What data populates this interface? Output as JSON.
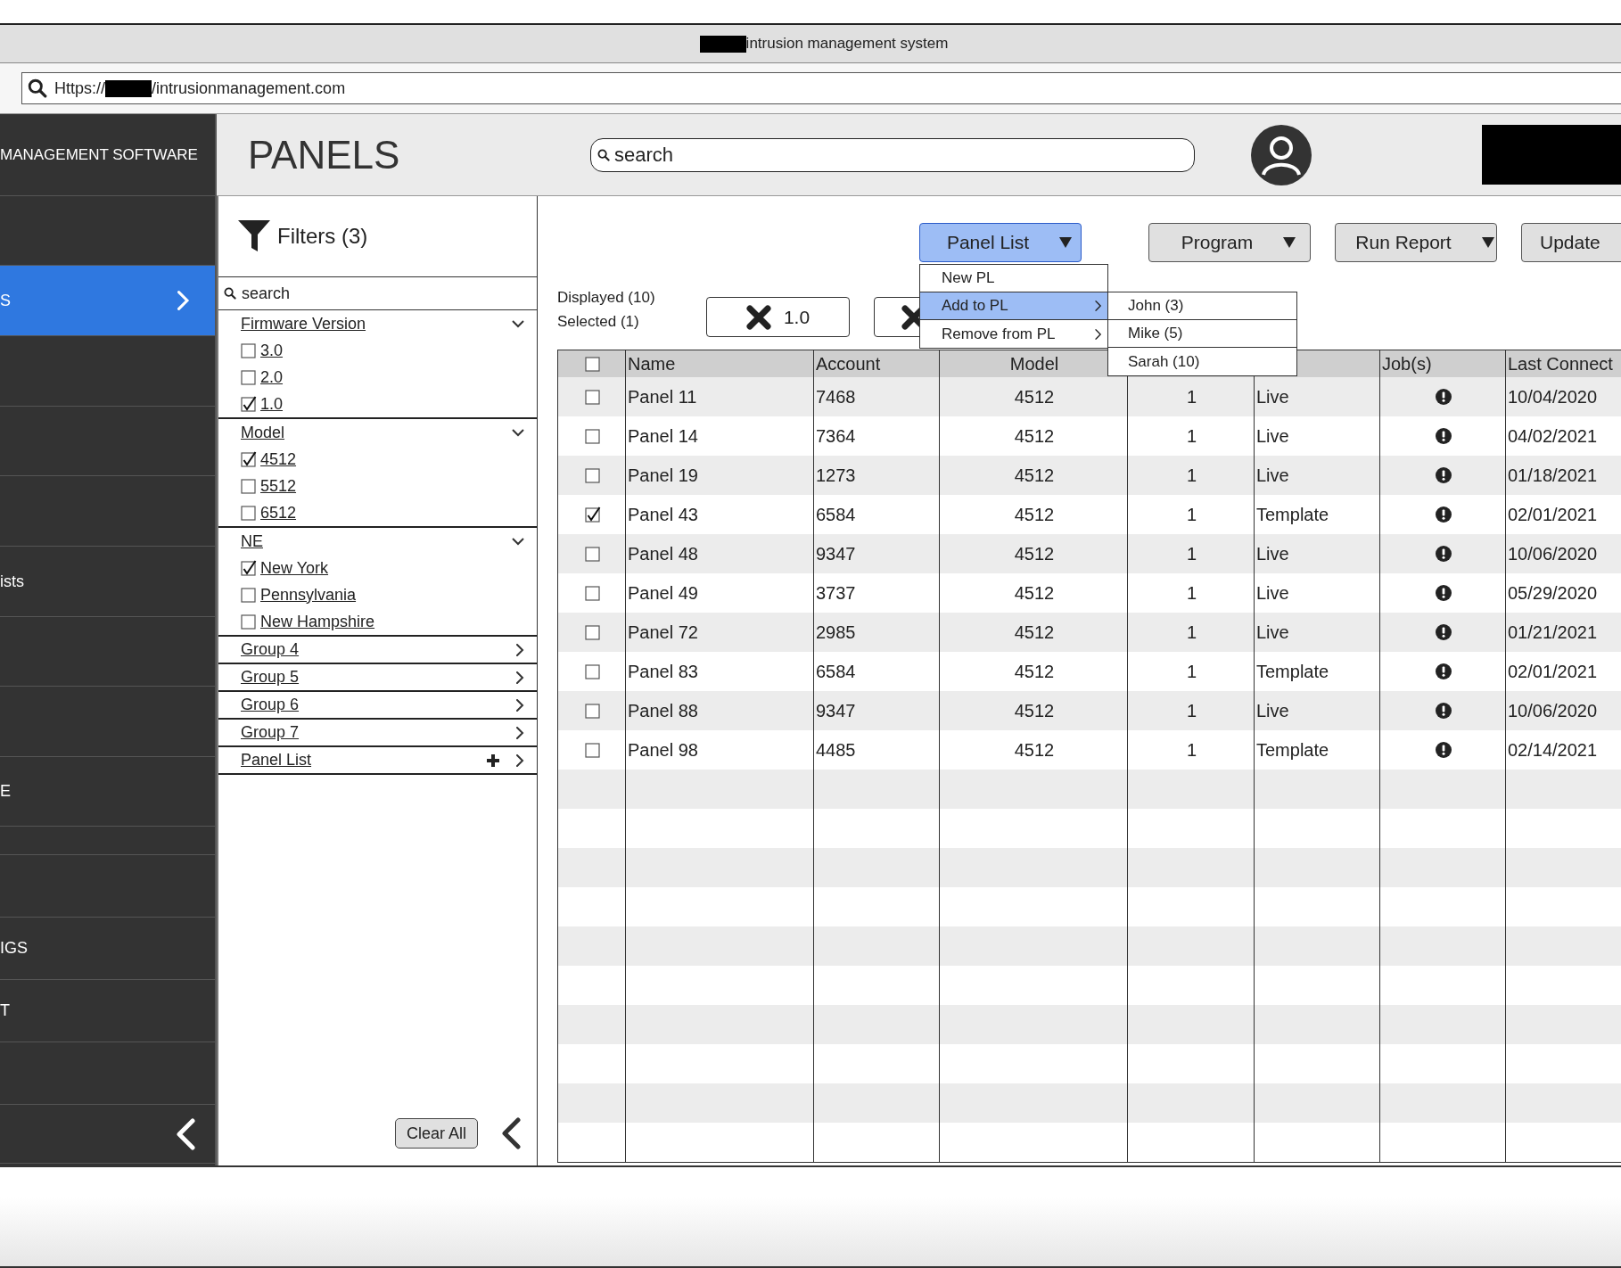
{
  "browser": {
    "title": "intrusion management system",
    "url_prefix": "Https://",
    "url_suffix": "/intrusionmanagement.com"
  },
  "sidebar": {
    "brand": "MANAGEMENT SOFTWARE",
    "items": [
      {
        "kind": "link",
        "selected": false
      },
      {
        "kind": "link",
        "label": "S",
        "selected": true
      },
      {
        "kind": "link",
        "selected": false
      },
      {
        "kind": "link",
        "selected": false
      },
      {
        "kind": "link",
        "selected": false
      },
      {
        "kind": "link",
        "label": "ists",
        "selected": false
      },
      {
        "kind": "link",
        "selected": false
      },
      {
        "kind": "link",
        "selected": false
      },
      {
        "kind": "link",
        "label": "E",
        "selected": false
      },
      {
        "kind": "link",
        "selected": false
      },
      {
        "kind": "link",
        "selected": false
      },
      {
        "kind": "link",
        "label": "IGS",
        "selected": false
      },
      {
        "kind": "link",
        "label": "T",
        "selected": false
      },
      {
        "kind": "link",
        "selected": false
      },
      {
        "kind": "collapse",
        "selected": false
      }
    ]
  },
  "header": {
    "title": "PANELS",
    "search": {
      "placeholder": "search"
    }
  },
  "filters": {
    "title": "Filters (3)",
    "search": {
      "placeholder": "search"
    },
    "groups": [
      {
        "kind": "filter",
        "label": "Firmware Version",
        "expanded": true,
        "options": [
          {
            "label": "3.0",
            "checked": false
          },
          {
            "label": "2.0",
            "checked": false
          },
          {
            "label": "1.0",
            "checked": true
          }
        ]
      },
      {
        "kind": "filter",
        "label": "Model",
        "expanded": true,
        "options": [
          {
            "label": "4512",
            "checked": true
          },
          {
            "label": "5512",
            "checked": false
          },
          {
            "label": "6512",
            "checked": false
          }
        ]
      },
      {
        "kind": "filter",
        "label": "NE",
        "expanded": true,
        "options": [
          {
            "label": "New York",
            "checked": true
          },
          {
            "label": "Pennsylvania",
            "checked": false
          },
          {
            "label": "New Hampshire",
            "checked": false
          }
        ]
      },
      {
        "kind": "filter",
        "label": "Group 4",
        "expanded": false
      },
      {
        "kind": "filter",
        "label": "Group 5",
        "expanded": false
      },
      {
        "kind": "filter",
        "label": "Group 6",
        "expanded": false
      },
      {
        "kind": "filter",
        "label": "Group 7",
        "expanded": false
      },
      {
        "kind": "list",
        "label": "Panel List",
        "expanded": false
      }
    ],
    "clear_button": "Clear All"
  },
  "toolbar": {
    "buttons": [
      {
        "label": "Panel List",
        "expanded": true,
        "has_caret": true
      },
      {
        "label": "Program",
        "expanded": false,
        "has_caret": true
      },
      {
        "label": "Run Report",
        "expanded": false,
        "has_caret": true
      },
      {
        "label": "Update",
        "expanded": false,
        "has_caret": false
      }
    ]
  },
  "summary": {
    "displayed": "Displayed (10)",
    "selected": "Selected (1)"
  },
  "chips": [
    {
      "kind": "labeled",
      "label": "1.0"
    },
    {
      "kind": "covered"
    }
  ],
  "menu": {
    "items": [
      {
        "label": "New PL",
        "selected": false,
        "has_submenu": false
      },
      {
        "label": "Add to PL",
        "selected": true,
        "has_submenu": true
      },
      {
        "label": "Remove from PL",
        "selected": false,
        "has_submenu": true
      }
    ],
    "submenu": [
      {
        "label": "John (3)"
      },
      {
        "label": "Mike (5)"
      },
      {
        "label": "Sarah (10)"
      }
    ]
  },
  "table": {
    "header_checked": false,
    "columns": [
      {
        "kind": "text",
        "label": "Name"
      },
      {
        "kind": "text",
        "label": "Account"
      },
      {
        "kind": "center",
        "label": "Model"
      },
      {
        "kind": "covered"
      },
      {
        "kind": "covered"
      },
      {
        "kind": "text",
        "label": "Job(s)"
      },
      {
        "kind": "text",
        "label": "Last Connect"
      }
    ],
    "rows": [
      {
        "checked": false,
        "name": "Panel 11",
        "account": "7468",
        "model": "4512",
        "column_5": "1",
        "column_6": "Live",
        "alert": true,
        "last_connect": "10/04/2020"
      },
      {
        "checked": false,
        "name": "Panel 14",
        "account": "7364",
        "model": "4512",
        "column_5": "1",
        "column_6": "Live",
        "alert": true,
        "last_connect": "04/02/2021"
      },
      {
        "checked": false,
        "name": "Panel 19",
        "account": "1273",
        "model": "4512",
        "column_5": "1",
        "column_6": "Live",
        "alert": true,
        "last_connect": "01/18/2021"
      },
      {
        "checked": true,
        "name": "Panel 43",
        "account": "6584",
        "model": "4512",
        "column_5": "1",
        "column_6": "Template",
        "alert": true,
        "last_connect": "02/01/2021"
      },
      {
        "checked": false,
        "name": "Panel 48",
        "account": "9347",
        "model": "4512",
        "column_5": "1",
        "column_6": "Live",
        "alert": true,
        "last_connect": "10/06/2020"
      },
      {
        "checked": false,
        "name": "Panel 49",
        "account": "3737",
        "model": "4512",
        "column_5": "1",
        "column_6": "Live",
        "alert": true,
        "last_connect": "05/29/2020"
      },
      {
        "checked": false,
        "name": "Panel 72",
        "account": "2985",
        "model": "4512",
        "column_5": "1",
        "column_6": "Live",
        "alert": true,
        "last_connect": "01/21/2021"
      },
      {
        "checked": false,
        "name": "Panel 83",
        "account": "6584",
        "model": "4512",
        "column_5": "1",
        "column_6": "Template",
        "alert": true,
        "last_connect": "02/01/2021"
      },
      {
        "checked": false,
        "name": "Panel 88",
        "account": "9347",
        "model": "4512",
        "column_5": "1",
        "column_6": "Live",
        "alert": true,
        "last_connect": "10/06/2020"
      },
      {
        "checked": false,
        "name": "Panel 98",
        "account": "4485",
        "model": "4512",
        "column_5": "1",
        "column_6": "Template",
        "alert": true,
        "last_connect": "02/14/2021"
      }
    ]
  }
}
